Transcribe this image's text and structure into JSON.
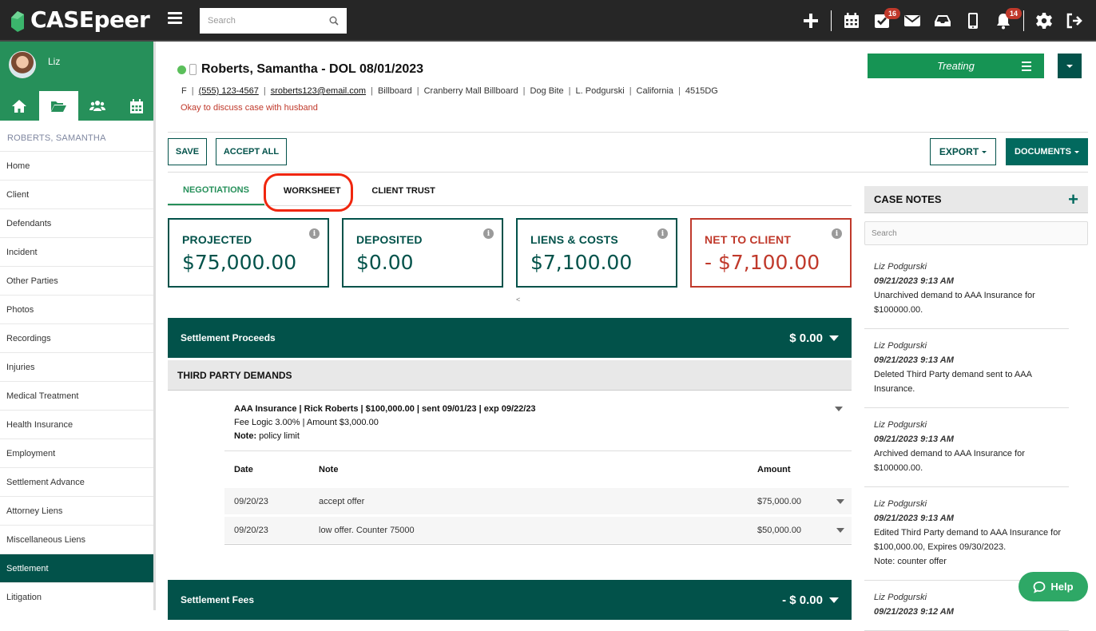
{
  "app": {
    "name": "CASEpeer"
  },
  "topbar": {
    "search_placeholder": "Search",
    "icons": [
      {
        "name": "plus-icon"
      },
      {
        "name": "calendar-icon"
      },
      {
        "name": "tasks-icon",
        "badge": "16"
      },
      {
        "name": "mail-icon"
      },
      {
        "name": "inbox-icon"
      },
      {
        "name": "mobile-icon"
      },
      {
        "name": "bell-icon",
        "badge": "14"
      },
      {
        "name": "gear-icon"
      },
      {
        "name": "logout-icon"
      }
    ]
  },
  "sidebar": {
    "user": "Liz",
    "case_name": "ROBERTS, SAMANTHA",
    "tabs": [
      "home-icon",
      "folder-open-icon",
      "users-icon",
      "calendar-icon"
    ],
    "items": [
      {
        "label": "Home"
      },
      {
        "label": "Client"
      },
      {
        "label": "Defendants"
      },
      {
        "label": "Incident"
      },
      {
        "label": "Other Parties"
      },
      {
        "label": "Photos"
      },
      {
        "label": "Recordings"
      },
      {
        "label": "Injuries"
      },
      {
        "label": "Medical Treatment"
      },
      {
        "label": "Health Insurance"
      },
      {
        "label": "Employment"
      },
      {
        "label": "Settlement Advance"
      },
      {
        "label": "Attorney Liens"
      },
      {
        "label": "Miscellaneous Liens"
      },
      {
        "label": "Settlement",
        "active": true
      },
      {
        "label": "Litigation"
      }
    ]
  },
  "case": {
    "title": "Roberts, Samantha - DOL 08/01/2023",
    "meta": {
      "gender": "F",
      "phone": "(555) 123-4567",
      "email": "sroberts123@email.com",
      "source": "Billboard",
      "source_detail": "Cranberry Mall Billboard",
      "case_type": "Dog Bite",
      "attorney": "L. Podgurski",
      "state": "California",
      "case_id": "4515DG"
    },
    "alert_note": "Okay to discuss case with husband",
    "status": "Treating"
  },
  "toolbar": {
    "save_label": "SAVE",
    "accept_all_label": "ACCEPT ALL",
    "export_label": "EXPORT",
    "documents_label": "DOCUMENTS"
  },
  "tabs": [
    {
      "label": "NEGOTIATIONS",
      "active": true
    },
    {
      "label": "WORKSHEET",
      "highlighted": true
    },
    {
      "label": "CLIENT TRUST"
    }
  ],
  "summary_cards": [
    {
      "label": "PROJECTED",
      "value": "$75,000.00"
    },
    {
      "label": "DEPOSITED",
      "value": "$0.00"
    },
    {
      "label": "LIENS & COSTS",
      "value": "$7,100.00"
    },
    {
      "label": "NET TO CLIENT",
      "value": "- $7,100.00",
      "negative": true
    }
  ],
  "scroll_left_glyph": "<",
  "settlement_proceeds": {
    "title": "Settlement Proceeds",
    "amount": "$ 0.00"
  },
  "third_party_demands": {
    "title": "THIRD PARTY DEMANDS",
    "demand": {
      "line1": "AAA Insurance | Rick Roberts | $100,000.00 | sent 09/01/23 | exp 09/22/23",
      "line2": "Fee Logic 3.00% | Amount $3,000.00",
      "note_label": "Note:",
      "note_value": "policy limit"
    },
    "table": {
      "headers": {
        "date": "Date",
        "note": "Note",
        "amount": "Amount"
      },
      "rows": [
        {
          "date": "09/20/23",
          "note": "accept offer",
          "amount": "$75,000.00"
        },
        {
          "date": "09/20/23",
          "note": "low offer. Counter 75000",
          "amount": "$50,000.00"
        }
      ]
    }
  },
  "settlement_fees": {
    "title": "Settlement Fees",
    "amount": "- $ 0.00"
  },
  "case_notes": {
    "title": "CASE NOTES",
    "search_placeholder": "Search",
    "notes": [
      {
        "author": "Liz Podgurski",
        "timestamp": "09/21/2023 9:13 AM",
        "text": "Unarchived demand to AAA Insurance for $100000.00."
      },
      {
        "author": "Liz Podgurski",
        "timestamp": "09/21/2023 9:13 AM",
        "text": "Deleted Third Party demand sent to AAA Insurance."
      },
      {
        "author": "Liz Podgurski",
        "timestamp": "09/21/2023 9:13 AM",
        "text": "Archived demand to AAA Insurance for $100000.00."
      },
      {
        "author": "Liz Podgurski",
        "timestamp": "09/21/2023 9:13 AM",
        "text": "Edited Third Party demand to AAA Insurance for $100,000.00, Expires 09/30/2023.",
        "extra": "Note: counter offer"
      },
      {
        "author": "Liz Podgurski",
        "timestamp": "09/21/2023 9:12 AM",
        "text": ""
      }
    ]
  },
  "help": {
    "label": "Help"
  },
  "colors": {
    "brand_green": "#26905a",
    "dark_teal": "#02524a",
    "alert_red": "#c0392b",
    "highlight_red": "#f0260e",
    "status_green": "#169454"
  }
}
